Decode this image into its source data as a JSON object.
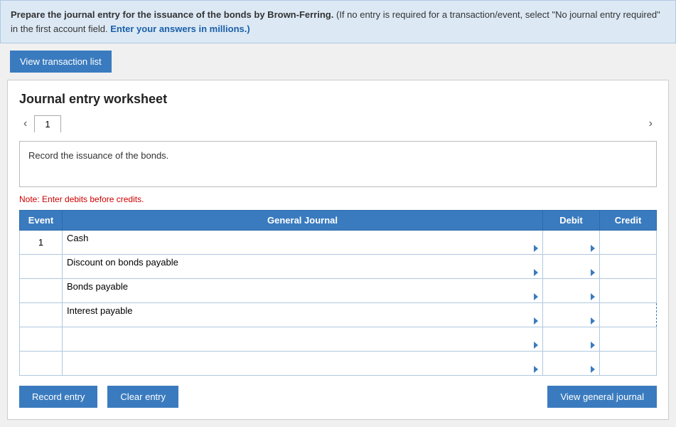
{
  "instructions": {
    "text1": "Prepare the journal entry for the issuance of the bonds by Brown-Ferring.",
    "text2": "(If no entry is required for a transaction/event, select \"No journal entry required\" in the first account field.",
    "text3": "Enter your answers in millions.)",
    "view_transaction_label": "View transaction list"
  },
  "worksheet": {
    "title": "Journal entry worksheet",
    "tab_number": "1",
    "description": "Record the issuance of the bonds.",
    "note": "Note: Enter debits before credits.",
    "table": {
      "headers": {
        "event": "Event",
        "general_journal": "General Journal",
        "debit": "Debit",
        "credit": "Credit"
      },
      "rows": [
        {
          "event": "1",
          "account": "Cash",
          "debit": "",
          "credit": "",
          "credit_dashed": false
        },
        {
          "event": "",
          "account": "Discount on bonds payable",
          "debit": "",
          "credit": "",
          "credit_dashed": false
        },
        {
          "event": "",
          "account": "Bonds payable",
          "debit": "",
          "credit": "",
          "credit_dashed": false
        },
        {
          "event": "",
          "account": "Interest payable",
          "debit": "",
          "credit": "",
          "credit_dashed": true
        },
        {
          "event": "",
          "account": "",
          "debit": "",
          "credit": "",
          "credit_dashed": false
        },
        {
          "event": "",
          "account": "",
          "debit": "",
          "credit": "",
          "credit_dashed": false
        }
      ]
    },
    "buttons": {
      "record_entry": "Record entry",
      "clear_entry": "Clear entry",
      "view_general_journal": "View general journal"
    }
  }
}
